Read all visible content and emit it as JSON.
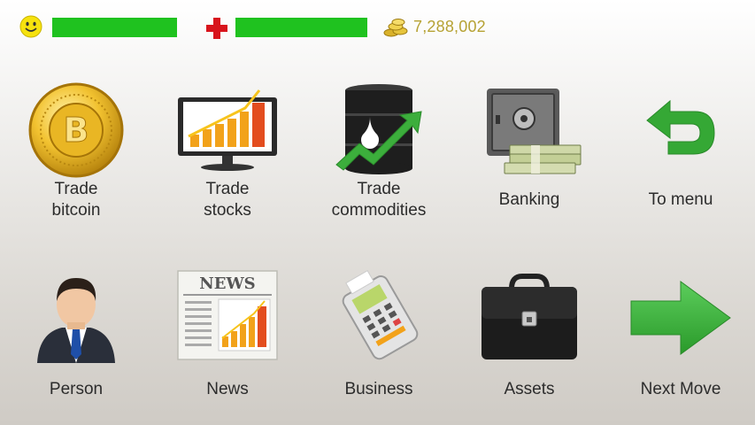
{
  "hud": {
    "happiness_level": 1.0,
    "health_level": 1.0,
    "money": "7,288,002",
    "bar_color": "#1fc21f",
    "icons": [
      "smiley-icon",
      "health-cross-icon",
      "coins-icon"
    ]
  },
  "menu": {
    "trade_bitcoin": [
      "Trade",
      "bitcoin"
    ],
    "trade_stocks": [
      "Trade",
      "stocks"
    ],
    "trade_commodities": [
      "Trade",
      "commodities"
    ],
    "banking": "Banking",
    "to_menu": "To menu",
    "person": "Person",
    "news": "News",
    "business": "Business",
    "assets": "Assets",
    "next_move": "Next Move"
  }
}
